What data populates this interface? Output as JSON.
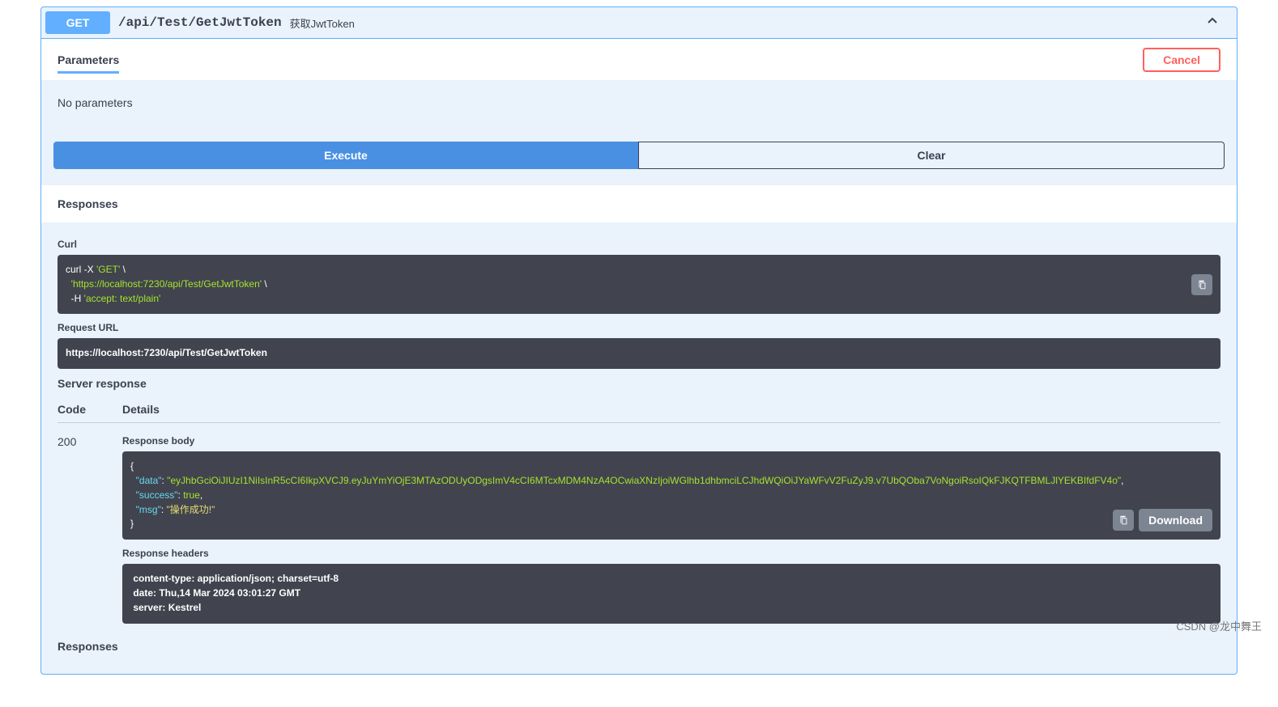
{
  "endpoint": {
    "method": "GET",
    "path": "/api/Test/GetJwtToken",
    "description": "获取JwtToken"
  },
  "parameters": {
    "title": "Parameters",
    "cancel_label": "Cancel",
    "empty_text": "No parameters"
  },
  "actions": {
    "execute_label": "Execute",
    "clear_label": "Clear",
    "download_label": "Download"
  },
  "responses": {
    "title": "Responses",
    "curl_label": "Curl",
    "curl_l1_a": "curl -X ",
    "curl_l1_b": "'GET'",
    "curl_l1_c": " \\",
    "curl_l2_a": "  ",
    "curl_l2_b": "'https://localhost:7230/api/Test/GetJwtToken'",
    "curl_l2_c": " \\",
    "curl_l3_a": "  -H ",
    "curl_l3_b": "'accept: text/plain'",
    "request_url_label": "Request URL",
    "request_url": "https://localhost:7230/api/Test/GetJwtToken",
    "server_response_label": "Server response",
    "code_header": "Code",
    "details_header": "Details",
    "status_code": "200",
    "response_body_label": "Response body",
    "body_l1": "{",
    "body_l2_k": "  \"data\"",
    "body_l2_c": ": ",
    "body_l2_v": "\"eyJhbGciOiJIUzI1NiIsInR5cCI6IkpXVCJ9.eyJuYmYiOjE3MTAzODUyODgsImV4cCI6MTcxMDM4NzA4OCwiaXNzIjoiWGlhb1dhbmciLCJhdWQiOiJYaWFvV2FuZyJ9.v7UbQOba7VoNgoiRsoIQkFJKQTFBMLJlYEKBIfdFV4o\"",
    "body_l2_e": ",",
    "body_l3_k": "  \"success\"",
    "body_l3_c": ": ",
    "body_l3_v": "true",
    "body_l3_e": ",",
    "body_l4_k": "  \"msg\"",
    "body_l4_c": ": ",
    "body_l4_v": "\"操作成功!\"",
    "body_l5": "}",
    "response_headers_label": "Response headers",
    "header_l1": " content-type: application/json; charset=utf-8 ",
    "header_l2": " date: Thu,14 Mar 2024 03:01:27 GMT ",
    "header_l3": " server: Kestrel ",
    "responses2_label": "Responses"
  },
  "watermark": "CSDN @龙中舞王"
}
